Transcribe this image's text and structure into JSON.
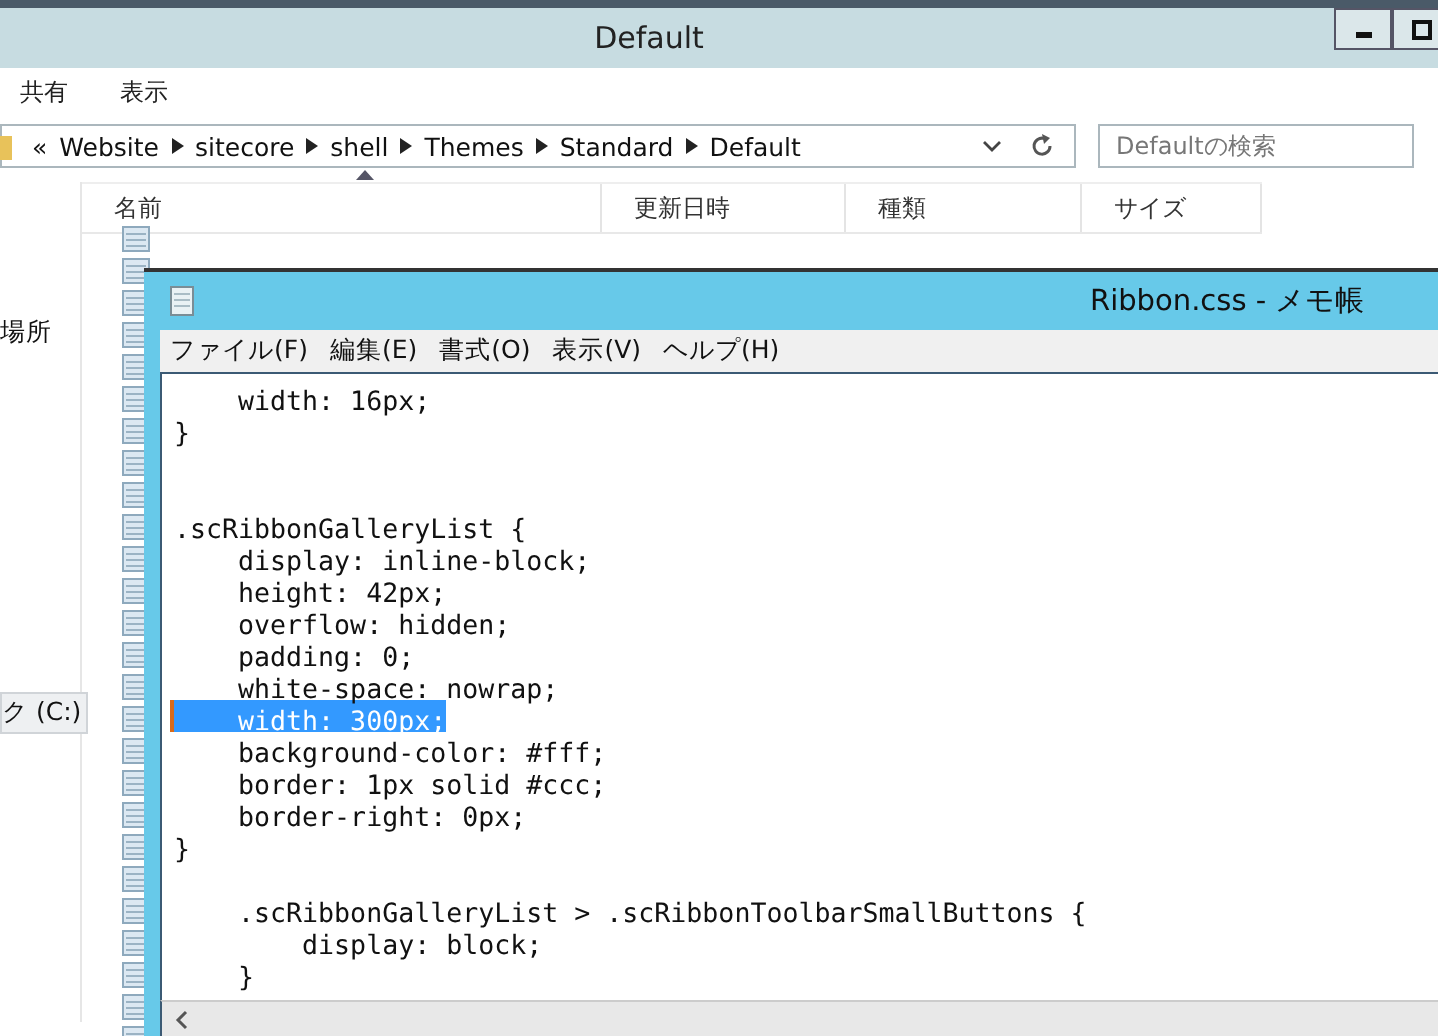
{
  "explorer": {
    "title": "Default",
    "ribbon_tabs": [
      {
        "label": "共有"
      },
      {
        "label": "表示"
      }
    ],
    "address": {
      "overflow": "«",
      "crumbs": [
        "Website",
        "sitecore",
        "shell",
        "Themes",
        "Standard",
        "Default"
      ]
    },
    "search": {
      "placeholder": "Defaultの検索"
    },
    "nav_items": [
      {
        "label": "場所",
        "selected": false
      },
      {
        "label": "ク (C:)",
        "selected": true
      }
    ],
    "columns": [
      "名前",
      "更新日時",
      "種類",
      "サイズ"
    ]
  },
  "notepad": {
    "title": "Ribbon.css - メモ帳",
    "menu": [
      "ファイル(F)",
      "編集(E)",
      "書式(O)",
      "表示(V)",
      "ヘルプ(H)"
    ],
    "lines": [
      {
        "text": "    width: 16px;",
        "selected": false
      },
      {
        "text": "}",
        "selected": false
      },
      {
        "selected": false
      },
      {
        "selected": false
      },
      {
        "text": ".scRibbonGalleryList {",
        "selected": false
      },
      {
        "text": "    display: inline-block;",
        "selected": false
      },
      {
        "text": "    height: 42px;",
        "selected": false
      },
      {
        "text": "    overflow: hidden;",
        "selected": false
      },
      {
        "text": "    padding: 0;",
        "selected": false
      },
      {
        "text": "    white-space: nowrap;",
        "selected": false
      },
      {
        "text": "    width: 300px;",
        "selected": true
      },
      {
        "text": "    background-color: #fff;",
        "selected": false
      },
      {
        "text": "    border: 1px solid #ccc;",
        "selected": false
      },
      {
        "text": "    border-right: 0px;",
        "selected": false
      },
      {
        "text": "}",
        "selected": false
      },
      {
        "selected": false
      },
      {
        "text": "    .scRibbonGalleryList > .scRibbonToolbarSmallButtons {",
        "selected": false
      },
      {
        "text": "        display: block;",
        "selected": false
      },
      {
        "text": "    }",
        "selected": false
      }
    ]
  }
}
